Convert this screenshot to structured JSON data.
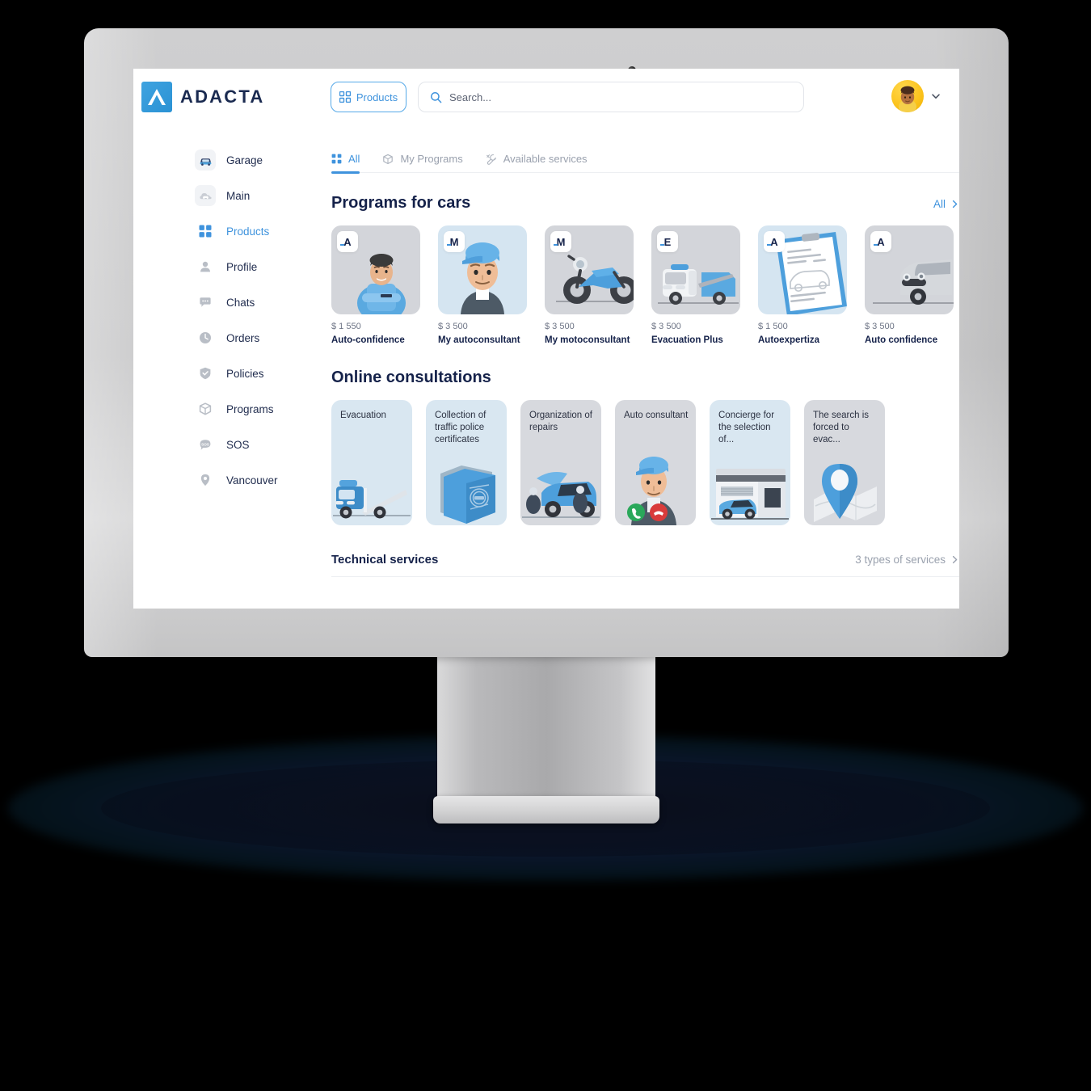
{
  "brand": {
    "name": "ADACTA",
    "mark_color": "#2f93d6",
    "text_color": "#1a2a50"
  },
  "header": {
    "products_button": "Products",
    "products_icon": "grid-icon",
    "search_placeholder": "Search...",
    "search_icon": "search-icon",
    "search_value": "",
    "avatar_icon": "user-avatar",
    "chevron_icon": "chevron-down-icon"
  },
  "sidebar": {
    "items": [
      {
        "label": "Garage",
        "icon": "car-icon",
        "active": false,
        "tinted": true
      },
      {
        "label": "Main",
        "icon": "cloud-car-icon",
        "active": false,
        "tinted": true
      },
      {
        "label": "Products",
        "icon": "grid-icon",
        "active": true,
        "tinted": false
      },
      {
        "label": "Profile",
        "icon": "person-icon",
        "active": false,
        "tinted": false
      },
      {
        "label": "Chats",
        "icon": "chat-icon",
        "active": false,
        "tinted": false
      },
      {
        "label": "Orders",
        "icon": "clock-icon",
        "active": false,
        "tinted": false
      },
      {
        "label": "Policies",
        "icon": "shield-check-icon",
        "active": false,
        "tinted": false
      },
      {
        "label": "Programs",
        "icon": "box-icon",
        "active": false,
        "tinted": false
      },
      {
        "label": "SOS",
        "icon": "sos-icon",
        "active": false,
        "tinted": false
      },
      {
        "label": "Vancouver",
        "icon": "location-pin-icon",
        "active": false,
        "tinted": false
      }
    ]
  },
  "tabs": [
    {
      "label": "All",
      "icon": "grid-icon",
      "active": true
    },
    {
      "label": "My Programs",
      "icon": "box-icon",
      "active": false
    },
    {
      "label": "Available services",
      "icon": "wrench-icon",
      "active": false
    }
  ],
  "programs_section": {
    "title": "Programs for cars",
    "link": "All",
    "link_icon": "chevron-right-icon",
    "cards": [
      {
        "badge": "A",
        "price": "$ 1 550",
        "name": "Auto-confidence",
        "art": "mechanic-arms-crossed",
        "bg": "gray"
      },
      {
        "badge": "M",
        "price": "$ 3 500",
        "name": "My autoconsultant",
        "art": "mechanic-blue-cap",
        "bg": "blue"
      },
      {
        "badge": "M",
        "price": "$ 3 500",
        "name": "My motoconsultant",
        "art": "motorcycle",
        "bg": "gray"
      },
      {
        "badge": "E",
        "price": "$ 3 500",
        "name": "Evacuation Plus",
        "art": "tow-truck-white",
        "bg": "gray"
      },
      {
        "badge": "A",
        "price": "$ 1 500",
        "name": "Autoexpertiza",
        "art": "clipboard-inspection",
        "bg": "blue"
      },
      {
        "badge": "A",
        "price": "$ 3 500",
        "name": "Auto confidence",
        "art": "silver-car",
        "bg": "gray"
      }
    ]
  },
  "consultations_section": {
    "title": "Online consultations",
    "cards": [
      {
        "title": "Evacuation",
        "art": "blue-tow-truck",
        "bg": "blue"
      },
      {
        "title": "Collection of traffic police certificates",
        "art": "blue-folder",
        "bg": "blue"
      },
      {
        "title": "Organization of repairs",
        "art": "car-repair",
        "bg": "gray"
      },
      {
        "title": "Auto consultant",
        "art": "consultant-call",
        "bg": "gray"
      },
      {
        "title": "Concierge for the selection of...",
        "art": "dealership",
        "bg": "blue"
      },
      {
        "title": "The search is forced to evac...",
        "art": "map-pin",
        "bg": "gray"
      }
    ]
  },
  "technical_section": {
    "title": "Technical services",
    "link": "3 types of services",
    "link_icon": "chevron-right-icon"
  }
}
